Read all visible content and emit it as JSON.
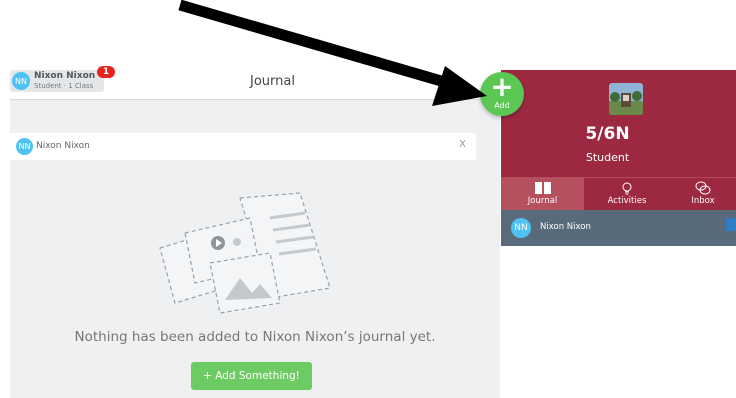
{
  "header": {
    "avatar_initials": "NN",
    "user_name": "Nixon Nixon",
    "user_subtitle": "Student · 1 Class",
    "notification_count": "1",
    "title": "Journal"
  },
  "student_bar": {
    "avatar_initials": "NN",
    "name": "Nixon Nixon",
    "close_label": "X"
  },
  "empty_state": {
    "message": "Nothing has been added to Nixon Nixon’s journal yet.",
    "button_label": "+ Add Something!"
  },
  "fab": {
    "plus": "+",
    "label": "Add"
  },
  "class_panel": {
    "class_name": "5/6N",
    "role": "Student",
    "tabs": [
      {
        "label": "Journal",
        "icon": "book-icon"
      },
      {
        "label": "Activities",
        "icon": "lightbulb-icon"
      },
      {
        "label": "Inbox",
        "icon": "chat-bubbles-icon"
      }
    ],
    "student_row": {
      "avatar_initials": "NN",
      "name": "Nixon Nixon"
    }
  },
  "colors": {
    "brand_red": "#9c2940",
    "add_green": "#5bc854",
    "avatar_blue": "#4ec3f3",
    "badge_red": "#e8221f",
    "student_row": "#596b7a"
  }
}
